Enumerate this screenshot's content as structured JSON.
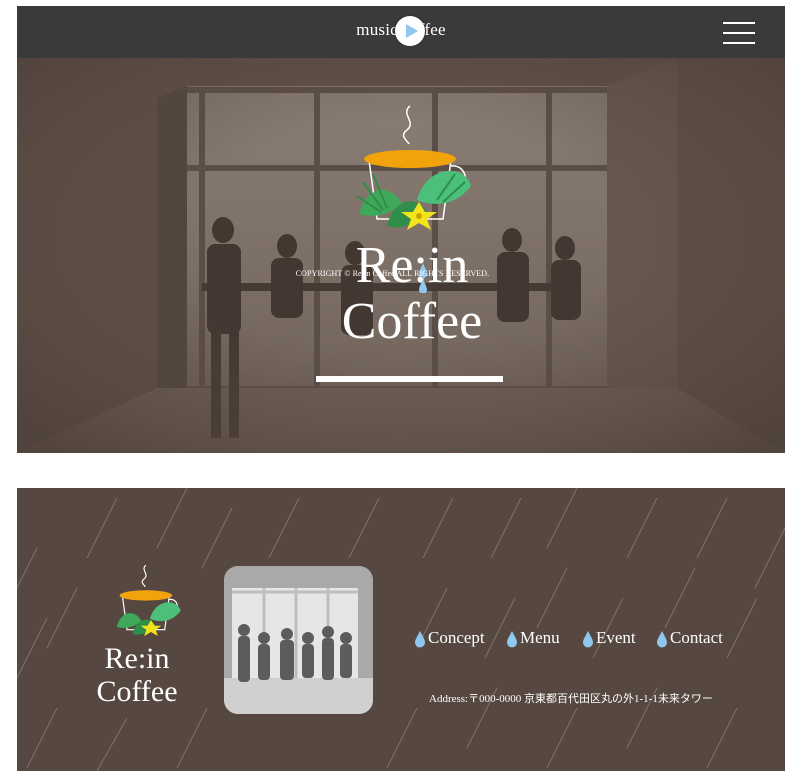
{
  "header": {
    "brand": "music coffee",
    "play_icon": "play-icon",
    "menu_icon": "hamburger-menu-icon"
  },
  "hero": {
    "title_line1": "Re:in",
    "title_line2": "Coffee",
    "logo_icon": "coffee-cup-with-leaves-icon"
  },
  "footer": {
    "logo_line1": "Re:in",
    "logo_line2": "Coffee",
    "nav": [
      {
        "label": "Concept",
        "icon": "water-drop-icon"
      },
      {
        "label": "Menu",
        "icon": "water-drop-icon"
      },
      {
        "label": "Event",
        "icon": "water-drop-icon"
      },
      {
        "label": "Contact",
        "icon": "water-drop-icon"
      }
    ],
    "address": "Address:〒000-0000 京東都百代田区丸の外1-1-1未来タワー",
    "copyright": "COPYRIGHT © Re:in Coffee ALL RIGHTS RESERVED."
  },
  "colors": {
    "header_bg": "#3a3a3a",
    "hero_overlay": "#5a4c44",
    "footer_bg": "#564840",
    "accent_orange": "#f2a20a",
    "leaf_green": "#3fa85a",
    "drop_blue": "#8fc7ef"
  }
}
